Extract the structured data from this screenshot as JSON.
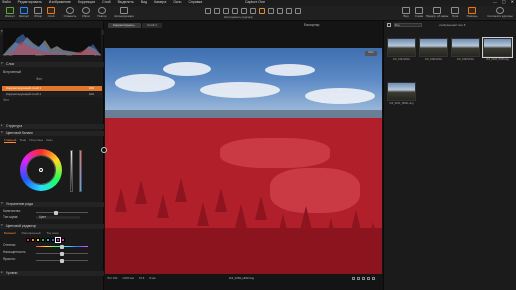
{
  "app_title": "Capture One",
  "menu": [
    "Файл",
    "Редактировать",
    "Изображение",
    "Коррекция",
    "Слой",
    "Выделить",
    "Вид",
    "Камера",
    "Окно",
    "Справка"
  ],
  "window_controls": [
    "—",
    "▢",
    "✕"
  ],
  "toolbar_left": [
    {
      "label": "Импорт",
      "icon": "import-icon",
      "style": "green"
    },
    {
      "label": "Экспорт",
      "icon": "export-icon",
      "style": "blue"
    },
    {
      "label": "Обзор",
      "icon": "browse-icon",
      "style": ""
    },
    {
      "label": "Слой",
      "icon": "layer-icon",
      "style": "orange"
    },
    {
      "label": "Отменить",
      "icon": "undo-icon",
      "style": "round"
    },
    {
      "label": "Сброс",
      "icon": "reset-icon",
      "style": "round"
    },
    {
      "label": "Повтор",
      "icon": "redo-icon",
      "style": "round"
    },
    {
      "label": "Автокоррекция",
      "icon": "auto-adjust-icon",
      "style": ""
    }
  ],
  "cursor_tools_label": "Инструменты курсора",
  "toolbar_right": [
    {
      "label": "Вид",
      "icon": "view-icon",
      "style": ""
    },
    {
      "label": "Слева",
      "icon": "left-icon",
      "style": ""
    },
    {
      "label": "Предпр. об.экран",
      "icon": "preview-icon",
      "style": ""
    },
    {
      "label": "Лупа",
      "icon": "loupe-icon",
      "style": ""
    },
    {
      "label": "Помощь",
      "icon": "help-icon",
      "style": "orange"
    },
    {
      "label": "Соотнести курсоры",
      "icon": "cursors-icon",
      "style": "round"
    }
  ],
  "left_panel": {
    "histogram_title": "Гистограмма",
    "hist_ticks": [
      "ISO 100",
      "1/250 s",
      "f/5.6",
      "8 mm"
    ],
    "layers_title": "Слои",
    "background_label": "Фон",
    "preset_label": "Встроенный",
    "layers": [
      {
        "name": "Корректирующий слой 1",
        "value": "100"
      },
      {
        "name": "Корректирующий слой 1",
        "value": "100"
      }
    ],
    "structure_title": "Структура",
    "color_balance_title": "Цветовой баланс",
    "cb_tabs": [
      "Главный",
      "Тени",
      "Полутона",
      "Свет"
    ],
    "cb_active": "Главный",
    "noise_title": "Устранение ряда",
    "noise_rows": [
      "Количество:",
      "Тип шума:"
    ],
    "noise_value": "Цвет",
    "color_editor_title": "Цветовой редактор",
    "ce_tabs": [
      "Базовый",
      "Расширенный",
      "Тон кожи"
    ],
    "ce_active": "Базовый",
    "ce_rows": [
      "Оттенок:",
      "Насыщенность:",
      "Яркость:"
    ],
    "levels_title": "Уровни"
  },
  "viewer": {
    "tabs": [
      "Корректирующ...",
      "Слой 1"
    ],
    "export_label": "Експортир",
    "badge": "Гист.",
    "status_items": [
      "ISO 100",
      "1/250 мм",
      "f/2.8",
      "8 мм"
    ],
    "filename": "DJI_0183_HDR.dng"
  },
  "browser": {
    "filter_label": "Все",
    "count_label": "изображений: все 8",
    "thumbs": [
      {
        "cap": "DJI_0181.DNG"
      },
      {
        "cap": "DJI_0182.DNG"
      },
      {
        "cap": "DJI_0183.DNG"
      },
      {
        "cap": "DJI_0183_HDR.dng"
      },
      {
        "cap": "DJI_0183_HDR1.dng"
      }
    ]
  }
}
